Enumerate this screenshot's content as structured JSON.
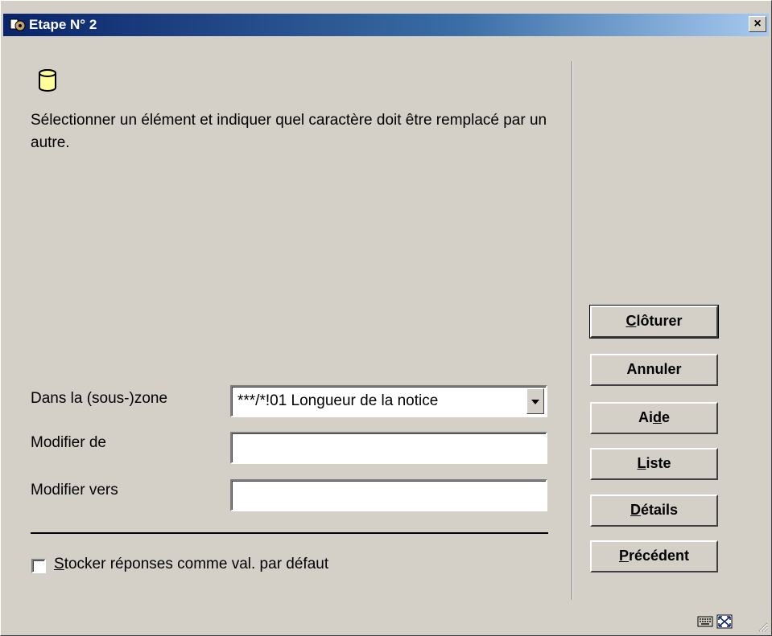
{
  "window": {
    "title": "Etape N° 2",
    "close_glyph": "×"
  },
  "instruction": "Sélectionner un élément et indiquer quel caractère doit être remplacé par un autre.",
  "fields": {
    "subzone_label": "Dans la (sous-)zone",
    "subzone_value": "***/*!01 Longueur de la notice",
    "from_label": "Modifier de",
    "from_value": "",
    "to_label": "Modifier vers",
    "to_value": ""
  },
  "checkbox": {
    "label": "Stocker réponses comme val. par défaut",
    "checked": false
  },
  "buttons": {
    "close": {
      "pre": "",
      "u": "C",
      "post": "lôturer"
    },
    "cancel": {
      "pre": "Annuler",
      "u": "",
      "post": ""
    },
    "help": {
      "pre": "Ai",
      "u": "d",
      "post": "e"
    },
    "list": {
      "pre": "",
      "u": "L",
      "post": "iste"
    },
    "details": {
      "pre": "",
      "u": "D",
      "post": "étails"
    },
    "previous": {
      "pre": "",
      "u": "P",
      "post": "récédent"
    }
  },
  "icons": {
    "title": "app-icon",
    "database": "database-icon",
    "keyboard": "keyboard-icon",
    "maximize": "maximize-icon"
  }
}
